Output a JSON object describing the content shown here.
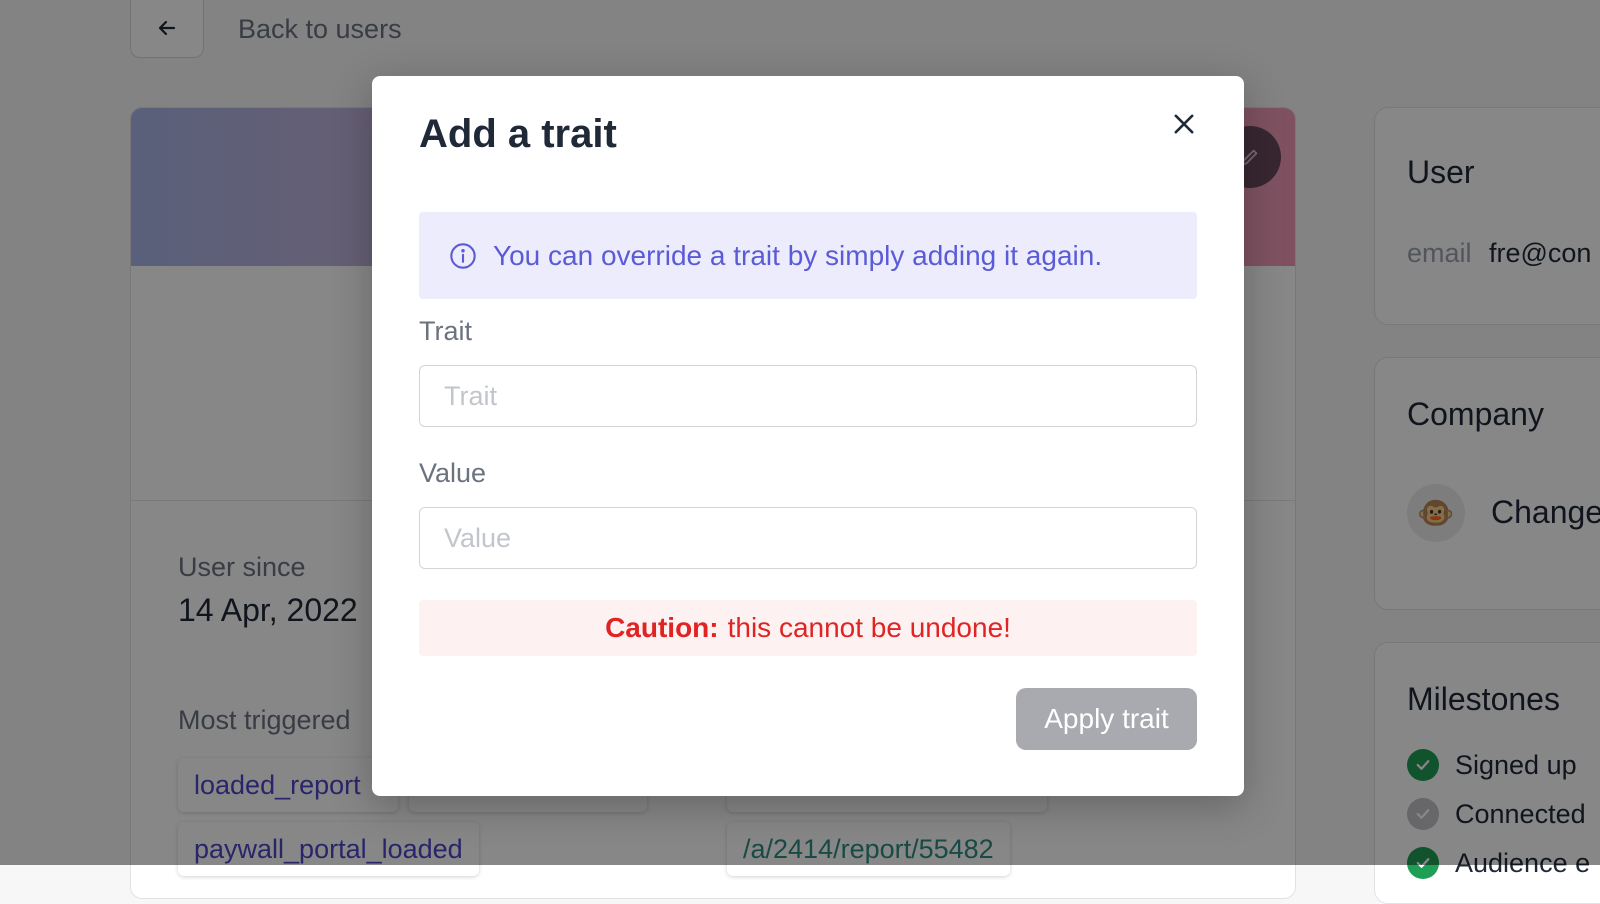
{
  "header": {
    "back_label": "Back to users"
  },
  "profile": {
    "user_since_label": "User since",
    "user_since_value": "14 Apr, 2022",
    "most_triggered_label": "Most triggered",
    "events": [
      "loaded_report",
      "paywall_portal_loaded"
    ],
    "pages": [
      "/a/2414/report/55482"
    ]
  },
  "sidebar": {
    "user_title": "User",
    "email_label": "email",
    "email_value": "fre@con",
    "company_title": "Company",
    "company_avatar": "🐵",
    "company_name": "Change",
    "milestones_title": "Milestones",
    "milestones": [
      {
        "label": "Signed up",
        "done": true
      },
      {
        "label": "Connected",
        "done": false
      },
      {
        "label": "Audience e",
        "done": true
      }
    ]
  },
  "modal": {
    "title": "Add a trait",
    "info_text": "You can override a trait by simply adding it again.",
    "trait_label": "Trait",
    "trait_placeholder": "Trait",
    "trait_value": "",
    "value_label": "Value",
    "value_placeholder": "Value",
    "value_value": "",
    "caution_strong": "Caution:",
    "caution_text": "this cannot be undone!",
    "apply_label": "Apply trait",
    "apply_disabled": true
  },
  "icons": {
    "back": "arrow-left-icon",
    "close": "close-icon",
    "info": "info-icon",
    "edit": "pencil-icon",
    "milestone_check": "check-circle-icon"
  },
  "colors": {
    "accent": "#5b5bd6",
    "info_bg": "#ececfd",
    "danger": "#e02424",
    "danger_bg": "#fdf1f1",
    "disabled_button": "#a8aab0",
    "success": "#1f9e55",
    "event_link": "#4f46c8",
    "page_link": "#2f8f83"
  }
}
